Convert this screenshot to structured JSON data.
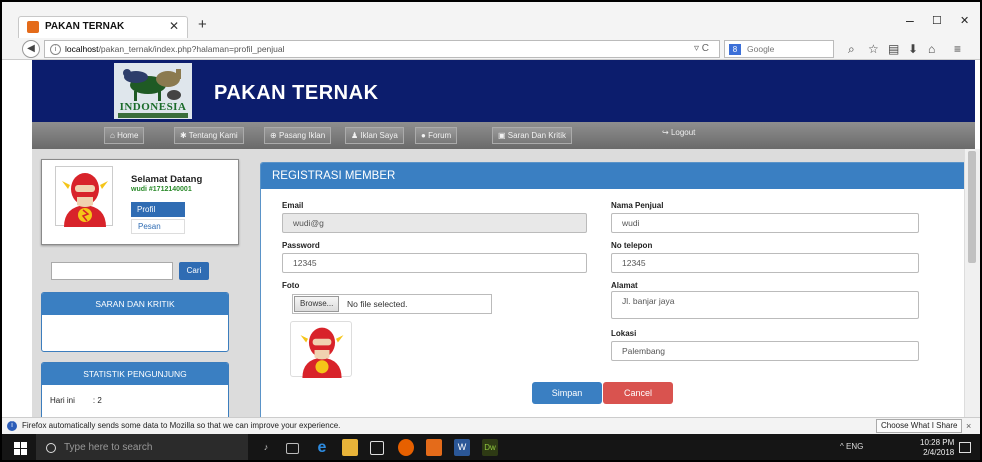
{
  "browser": {
    "tab_title": "PAKAN TERNAK",
    "new_tab_icon": "+",
    "url_host": "localhost",
    "url_path": "/pakan_ternak/index.php?halaman=profil_penjual",
    "search_engine": "Google",
    "window_controls": [
      "–",
      "☐",
      "✕"
    ]
  },
  "site": {
    "logo_text": "INDONESIA",
    "title": "PAKAN TERNAK",
    "header_color": "#0c1d6d"
  },
  "menu": {
    "items": [
      "Home",
      "Tentang Kami",
      "Pasang Iklan",
      "Iklan Saya",
      "Forum",
      "Saran Dan Kritik"
    ],
    "logout": "Logout"
  },
  "sidebar": {
    "welcome": "Selamat Datang",
    "user_id": "wudi  #1712140001",
    "profil_label": "Profil",
    "pesan_label": "Pesan",
    "search_button": "Cari",
    "saran_title": "SARAN DAN KRITIK",
    "stat_title": "STATISTIK PENGUNJUNG",
    "stat_label": "Hari ini",
    "stat_value": ": 2"
  },
  "form": {
    "title": "REGISTRASI MEMBER",
    "email_label": "Email",
    "email_value": "wudi@g",
    "password_label": "Password",
    "password_value": "12345",
    "foto_label": "Foto",
    "browse_label": "Browse...",
    "no_file": "No file selected.",
    "nama_label": "Nama Penjual",
    "nama_value": "wudi",
    "telepon_label": "No telepon",
    "telepon_value": "12345",
    "alamat_label": "Alamat",
    "alamat_value": "Jl. banjar jaya",
    "lokasi_label": "Lokasi",
    "lokasi_value": "Palembang",
    "submit_label": "Simpan",
    "cancel_label": "Cancel"
  },
  "notification": {
    "text": "Firefox automatically sends some data to Mozilla so that we can improve your experience.",
    "button": "Choose What I Share",
    "close": "×"
  },
  "taskbar": {
    "search_placeholder": "Type here to search",
    "time": "10:28 PM",
    "date": "2/4/2018",
    "tray_text": "^ ENG"
  }
}
